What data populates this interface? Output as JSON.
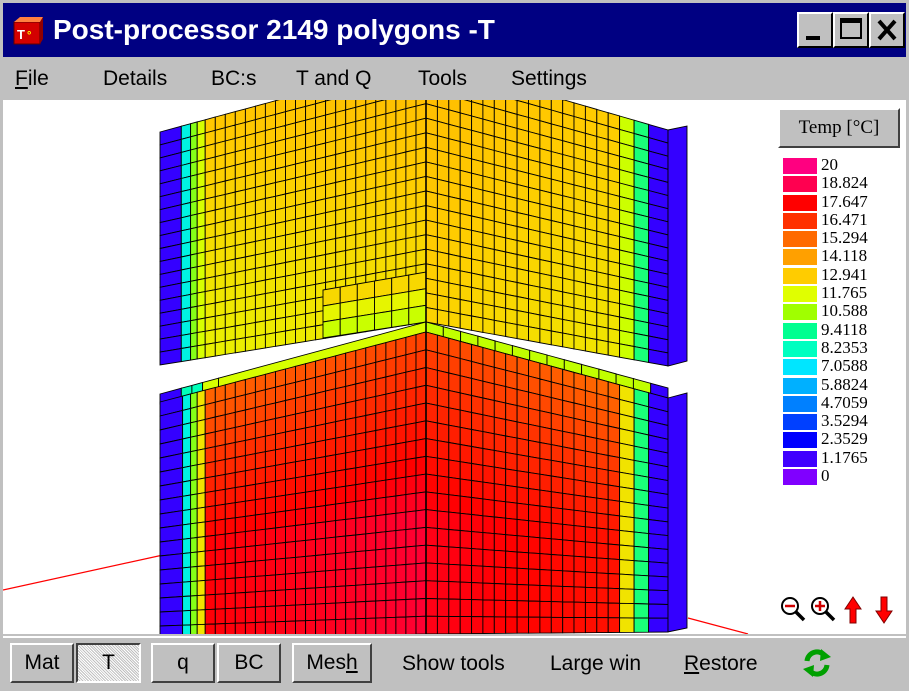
{
  "window": {
    "title": "Post-processor 2149 polygons  -T",
    "icon": "heat-app-icon",
    "controls": [
      "minimize-icon",
      "maximize-icon",
      "close-icon"
    ]
  },
  "menu": {
    "items": [
      {
        "label": "File",
        "underline": "F"
      },
      {
        "label": "Details"
      },
      {
        "label": "BC:s"
      },
      {
        "label": "T and Q"
      },
      {
        "label": "Tools"
      },
      {
        "label": "Settings"
      }
    ]
  },
  "legend": {
    "title": "Temp [°C]",
    "entries": [
      {
        "value": "20",
        "color": "#ff0080"
      },
      {
        "value": "18.824",
        "color": "#ff0050"
      },
      {
        "value": "17.647",
        "color": "#ff0000"
      },
      {
        "value": "16.471",
        "color": "#ff3000"
      },
      {
        "value": "15.294",
        "color": "#ff6a00"
      },
      {
        "value": "14.118",
        "color": "#ffa000"
      },
      {
        "value": "12.941",
        "color": "#ffcc00"
      },
      {
        "value": "11.765",
        "color": "#e0ff00"
      },
      {
        "value": "10.588",
        "color": "#a0ff00"
      },
      {
        "value": "9.4118",
        "color": "#00ff90"
      },
      {
        "value": "8.2353",
        "color": "#00ffc0"
      },
      {
        "value": "7.0588",
        "color": "#00e6ff"
      },
      {
        "value": "5.8824",
        "color": "#00b0ff"
      },
      {
        "value": "4.7059",
        "color": "#0080ff"
      },
      {
        "value": "3.5294",
        "color": "#0040ff"
      },
      {
        "value": "2.3529",
        "color": "#0000ff"
      },
      {
        "value": "1.1765",
        "color": "#4000ff"
      },
      {
        "value": "0",
        "color": "#8000ff"
      }
    ],
    "tools": [
      "zoom-out-icon",
      "zoom-in-icon",
      "arrow-up-icon",
      "arrow-down-icon"
    ]
  },
  "toolbar": {
    "buttons": [
      {
        "label": "Mat",
        "pressed": false
      },
      {
        "label": "T",
        "pressed": true
      },
      {
        "label": "q",
        "pressed": false
      },
      {
        "label": "BC",
        "pressed": false
      },
      {
        "label": "Mesh",
        "underline": "h",
        "pressed": false
      }
    ],
    "links": [
      {
        "label": "Show tools"
      },
      {
        "label": "Large win"
      },
      {
        "label": "Restore",
        "underline": "R"
      }
    ],
    "refresh_icon": "refresh-icon"
  }
}
